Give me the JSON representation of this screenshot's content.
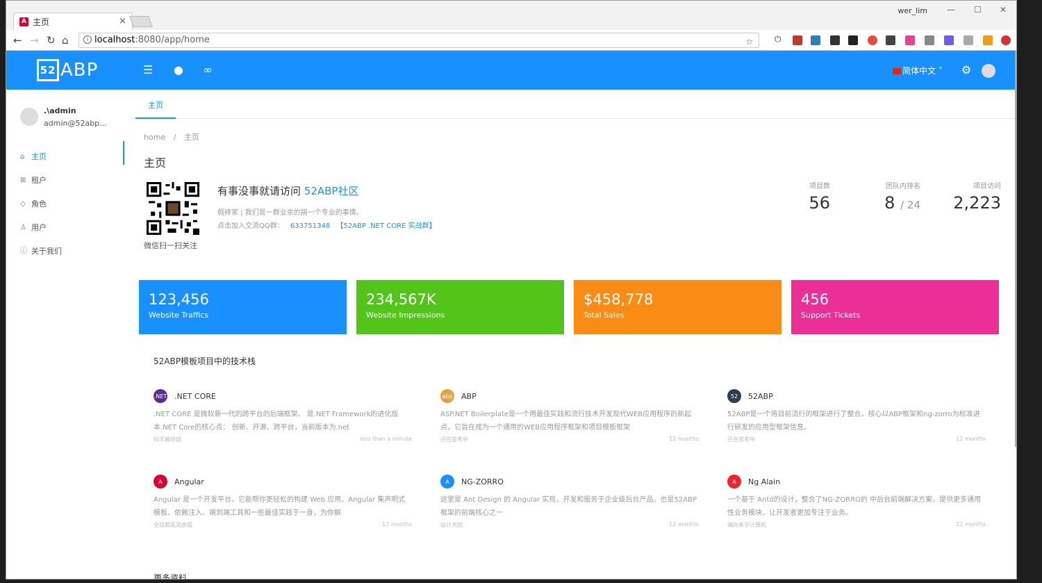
{
  "browser": {
    "tab_title": "主页",
    "tab_close": "×",
    "user_label": "wer_lim",
    "url_host": "localhost",
    "url_path": ":8080/app/home",
    "min": "—",
    "max": "☐",
    "close": "✕"
  },
  "header": {
    "logo_mark": "52",
    "logo_text": "ABP",
    "lang": "简体中文"
  },
  "sidebar": {
    "user_name": ".\\admin",
    "user_email": "admin@52abp...",
    "items": [
      {
        "label": "主页",
        "icon": "home-icon",
        "glyph": "⌂"
      },
      {
        "label": "租户",
        "icon": "apps-icon",
        "glyph": "⊞"
      },
      {
        "label": "角色",
        "icon": "safety-icon",
        "glyph": "◇"
      },
      {
        "label": "用户",
        "icon": "user-icon",
        "glyph": "♙"
      },
      {
        "label": "关于我们",
        "icon": "info-icon",
        "glyph": "ⓘ"
      }
    ]
  },
  "content": {
    "reuse_tab": "主页",
    "breadcrumb_home": "home",
    "breadcrumb_sep": "/",
    "breadcrumb_current": "主页",
    "page_title": "主页",
    "qr_caption": "微信扫一扫关注",
    "intro_title_prefix": "有事没事就请访问",
    "intro_title_link": "52ABP社区",
    "intro_line1": "假砖家 | 我们是一群业余的搞一个专业的事情。",
    "intro_line2_prefix": "点击加入交流QQ群：",
    "intro_qq": "633751348",
    "intro_group": "【52ABP .NET CORE 实战群】",
    "stats": [
      {
        "label": "项目数",
        "value": "56",
        "suffix": ""
      },
      {
        "label": "团队内排名",
        "value": "8",
        "suffix": "/ 24"
      },
      {
        "label": "项目访问",
        "value": "2,223",
        "suffix": ""
      }
    ],
    "cards": [
      {
        "value": "123,456",
        "desc": "Website Traffics",
        "color": "#1890ff"
      },
      {
        "value": "234,567K",
        "desc": "Website Impressions",
        "color": "#52c41a"
      },
      {
        "value": "$458,778",
        "desc": "Total Sales",
        "color": "#fa8c16"
      },
      {
        "value": "456",
        "desc": "Support Tickets",
        "color": "#eb2f96"
      }
    ],
    "section_title": "52ABP模板项目中的技术栈",
    "techs": [
      {
        "name": ".NET CORE",
        "icon_text": ".NET",
        "icon_color": "#5c2d91",
        "desc": ".NET CORE 是微软新一代的跨平台的后端框架、 是.NET Framework的进化版本.NET Core的核心点： 创新、开源、跨平台，当前版本为.net",
        "author": "科学搬砖组",
        "time": "less than a minute"
      },
      {
        "name": "ABP",
        "icon_text": "abp",
        "icon_color": "#e6a23c",
        "desc": "ASP.NET Boilerplate是一个用最佳实践和流行技术开发现代WEB应用程序的新起点，它旨在成为一个通用的WEB应用程序框架和项目模板框架",
        "author": "还在思考中",
        "time": "12 months"
      },
      {
        "name": "52ABP",
        "icon_text": "52",
        "icon_color": "#2c3e50",
        "desc": "52ABP是一个将目前流行的框架进行了整合，核心以ABP框架和ng-zorro为标准进行研发的应用型框架信息。",
        "author": "还在思考中",
        "time": "12 months"
      },
      {
        "name": "Angular",
        "icon_text": "A",
        "icon_color": "#dd0031",
        "desc": "Angular 是一个开发平台。它能帮你更轻松的构建 Web 应用。Angular 集声明式模板、依赖注入、端到端工具和一些最佳实践于一身，为你解",
        "author": "全组都是吴彦祖",
        "time": "12 months"
      },
      {
        "name": "NG-ZORRO",
        "icon_text": "A",
        "icon_color": "#1890ff",
        "desc": "这里是 Ant Design 的 Angular 实现，开发和服务于企业级后台产品。也是52ABP框架的前端核心之一",
        "author": "设计天团",
        "time": "12 months"
      },
      {
        "name": "Ng Alain",
        "icon_text": "A",
        "icon_color": "#f5222d",
        "desc": "一个基于 Antd的设计，整合了NG-ZORRO的 中后台前端解决方案，提供更多通用性业务模块，让开发者更加专注于业务。",
        "author": "编你来学计算机",
        "time": "12 months"
      }
    ],
    "more_title": "更多资料"
  }
}
